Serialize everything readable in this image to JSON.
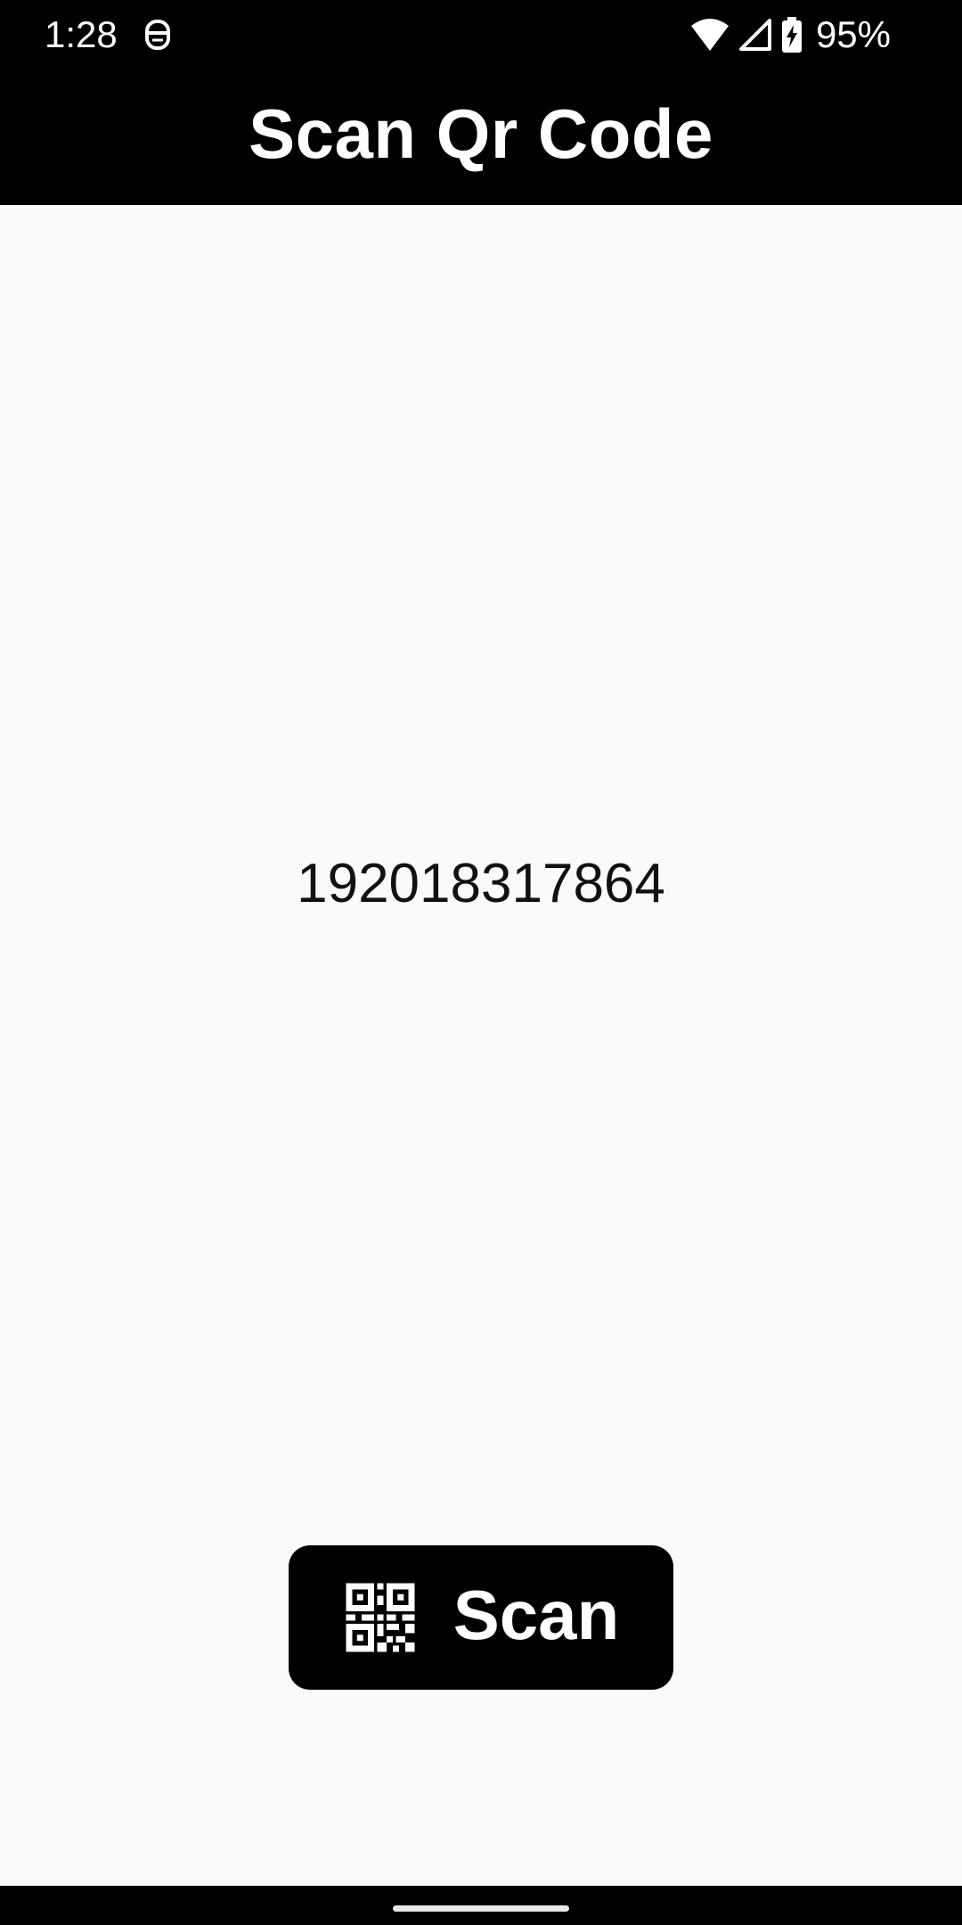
{
  "status_bar": {
    "time": "1:28",
    "left_icon": "face-icon",
    "wifi_icon": "wifi-icon",
    "signal_icon": "signal-icon",
    "battery_icon": "battery-charging-icon",
    "battery_percent": "95%"
  },
  "app_bar": {
    "title": "Scan Qr Code"
  },
  "result": {
    "text": "192018317864"
  },
  "scan_button": {
    "icon": "qr-code-icon",
    "label": "Scan"
  },
  "colors": {
    "bar_background": "#000000",
    "page_background": "#fafafa",
    "text_dark": "#111111",
    "text_light": "#ffffff"
  }
}
